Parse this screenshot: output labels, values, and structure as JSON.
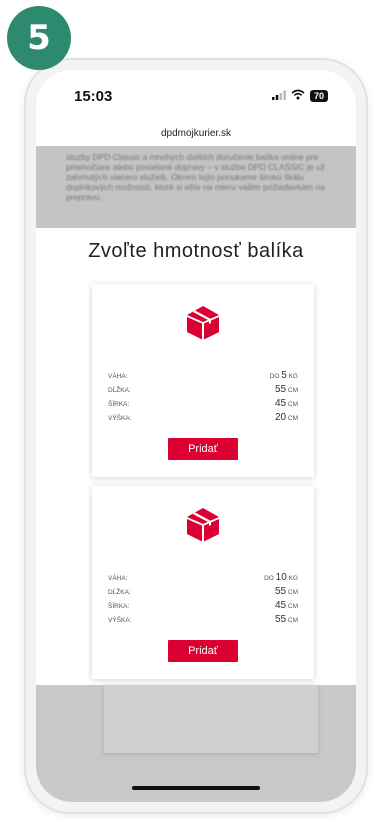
{
  "step": "5",
  "status_bar": {
    "time": "15:03",
    "battery": "70"
  },
  "url": "dpdmojkurier.sk",
  "background_text": "sluzby DPD Classic a mnohých ďalších doručenie balíka online pre priamočiare alebo posielané dopravy – v službe DPD CLASSIC je už zahrnutých viacero služieb. Okrem tejto ponukame širokú škálu doplnkových možností, ktoré si ešte na mieru vašim požiadavkám na prepravu.",
  "modal": {
    "title": "Zvoľte hmotnosť balíka"
  },
  "labels": {
    "weight": "VÁHA:",
    "length": "DĹŽKA:",
    "width": "ŠÍRKA:",
    "height": "VÝŠKA:"
  },
  "cards": [
    {
      "weight_prefix": "DO",
      "weight": "5",
      "weight_unit": "KG",
      "length": "55",
      "width": "45",
      "height": "20",
      "unit": "CM",
      "button": "Pridať"
    },
    {
      "weight_prefix": "DO",
      "weight": "10",
      "weight_unit": "KG",
      "length": "55",
      "width": "45",
      "height": "55",
      "unit": "CM",
      "button": "Pridať"
    }
  ],
  "colors": {
    "badge": "#2e8a6f",
    "dpd_red": "#dc0032"
  },
  "icons": {
    "cube": "dpd-cube-icon",
    "signal": "signal-icon",
    "wifi": "wifi-icon",
    "battery": "battery-icon"
  }
}
